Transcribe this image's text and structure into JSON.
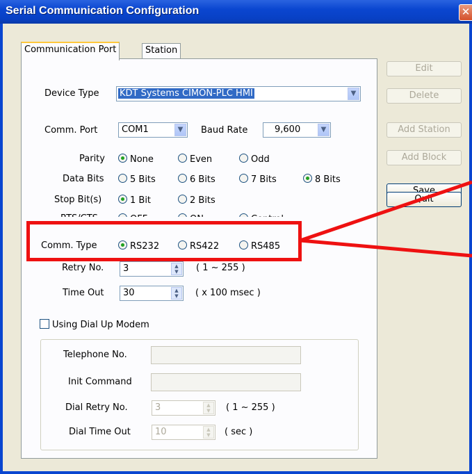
{
  "window": {
    "title": "Serial Communication Configuration",
    "close_glyph": "✕"
  },
  "tabs": [
    {
      "label": "Communication Port",
      "active": true
    },
    {
      "label": "Station",
      "active": false
    }
  ],
  "form": {
    "device_type_label": "Device Type",
    "device_type_value": "KDT Systems CIMON-PLC HMI",
    "comm_port_label": "Comm. Port",
    "comm_port_value": "COM1",
    "baud_rate_label": "Baud Rate",
    "baud_rate_value": "9,600",
    "parity_label": "Parity",
    "parity_options": [
      "None",
      "Even",
      "Odd"
    ],
    "parity_selected": "None",
    "data_bits_label": "Data Bits",
    "data_bits_options": [
      "5 Bits",
      "6 Bits",
      "7 Bits",
      "8 Bits"
    ],
    "data_bits_selected": "8 Bits",
    "stop_bits_label": "Stop Bit(s)",
    "stop_bits_options": [
      "1 Bit",
      "2 Bits"
    ],
    "stop_bits_selected": "1 Bit",
    "rts_cts_label": "RTS/CTS",
    "rts_cts_options": [
      "OFF",
      "ON",
      "Control"
    ],
    "comm_type_label": "Comm. Type",
    "comm_type_options": [
      "RS232",
      "RS422",
      "RS485"
    ],
    "comm_type_selected": "RS232",
    "retry_label": "Retry No.",
    "retry_value": "3",
    "retry_range": "( 1 ~ 255 )",
    "timeout_label": "Time Out",
    "timeout_value": "30",
    "timeout_unit": "( x 100 msec )"
  },
  "modem": {
    "checkbox_label": "Using Dial Up Modem",
    "checked": false,
    "telephone_label": "Telephone No.",
    "telephone_value": "",
    "init_command_label": "Init Command",
    "init_command_value": "",
    "dial_retry_label": "Dial Retry No.",
    "dial_retry_value": "3",
    "dial_retry_range": "( 1 ~ 255 )",
    "dial_timeout_label": "Dial Time Out",
    "dial_timeout_value": "10",
    "dial_timeout_unit": "( sec )"
  },
  "buttons": {
    "edit": "Edit",
    "delete": "Delete",
    "add_station": "Add Station",
    "add_block": "Add Block",
    "save": "Save",
    "quit": "Quit"
  },
  "annotation_color": "#ee1111"
}
